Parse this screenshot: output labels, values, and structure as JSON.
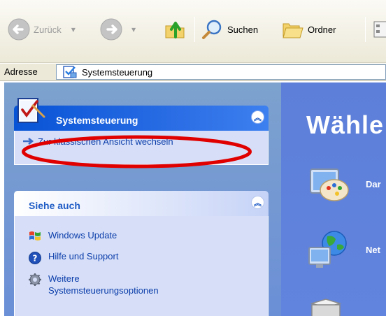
{
  "toolbar": {
    "back_label": "Zurück",
    "search_label": "Suchen",
    "folders_label": "Ordner"
  },
  "address": {
    "label": "Adresse",
    "value": "Systemsteuerung"
  },
  "left_pane": {
    "control_panel": {
      "title": "Systemsteuerung",
      "switch_view_link": "Zur klassischen Ansicht wechseln"
    },
    "see_also": {
      "title": "Siehe auch",
      "items": [
        {
          "label": "Windows Update",
          "icon": "windows-update-icon"
        },
        {
          "label": "Hilfe und Support",
          "icon": "help-icon"
        },
        {
          "label_line1": "Weitere",
          "label_line2": "Systemsteuerungsoptionen",
          "icon": "gear-icon"
        }
      ]
    }
  },
  "right_pane": {
    "heading": "Wähle",
    "categories": [
      "Dar",
      "Net"
    ]
  },
  "colors": {
    "highlight_ellipse": "#e00000",
    "task_header": "#0854d6",
    "link": "#0c3dab"
  }
}
